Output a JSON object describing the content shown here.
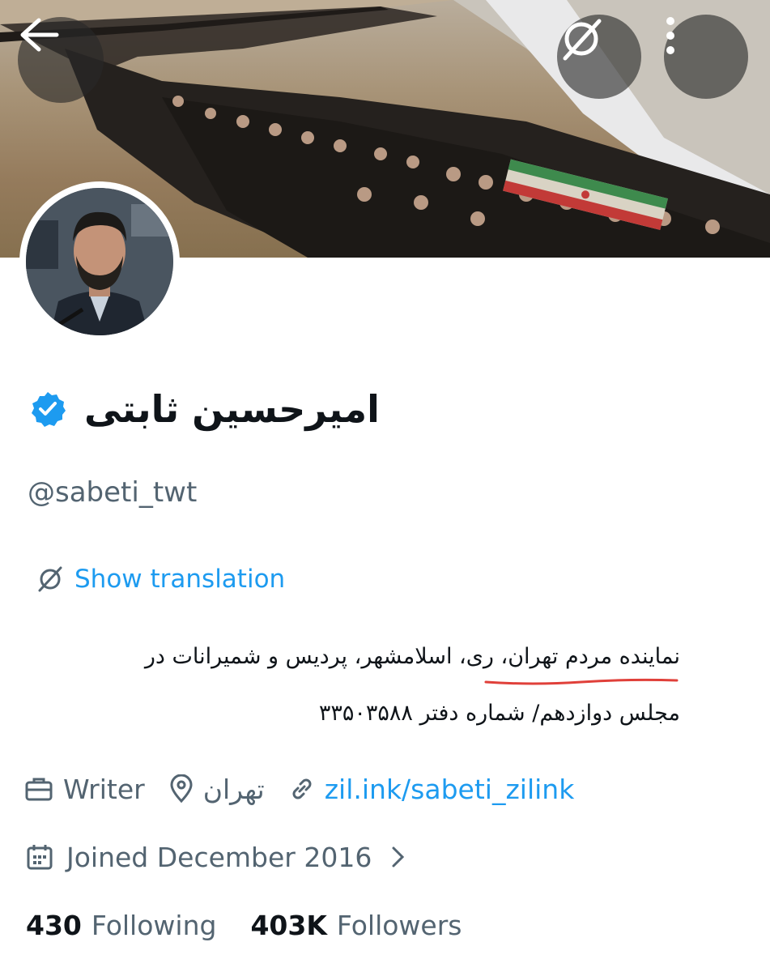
{
  "header": {
    "back_icon": "arrow-left-icon",
    "translate_icon": "translate-icon",
    "more_icon": "more-vertical-icon"
  },
  "profile": {
    "display_name": "امیرحسین ثابتی",
    "verified_icon": "verified-badge-icon",
    "verified_color": "#1d9bf0",
    "handle": "@sabeti_twt",
    "show_translation": "Show translation",
    "bio_line1": "نماینده مردم تهران، ری، اسلامشهر، پردیس و شمیرانات در",
    "bio_line2": "مجلس دوازدهم/ شماره دفتر ۳۳۵۰۳۵۸۸",
    "profession": "Writer",
    "location": "تهران",
    "website": "zil.ink/sabeti_zilink",
    "joined": "Joined December 2016"
  },
  "stats": {
    "following_count": "430",
    "following_label": "Following",
    "followers_count": "403K",
    "followers_label": "Followers"
  },
  "colors": {
    "accent": "#1d9bf0",
    "secondary_text": "#536471",
    "primary_text": "#0f1419",
    "annotation_underline": "#e0403a"
  }
}
